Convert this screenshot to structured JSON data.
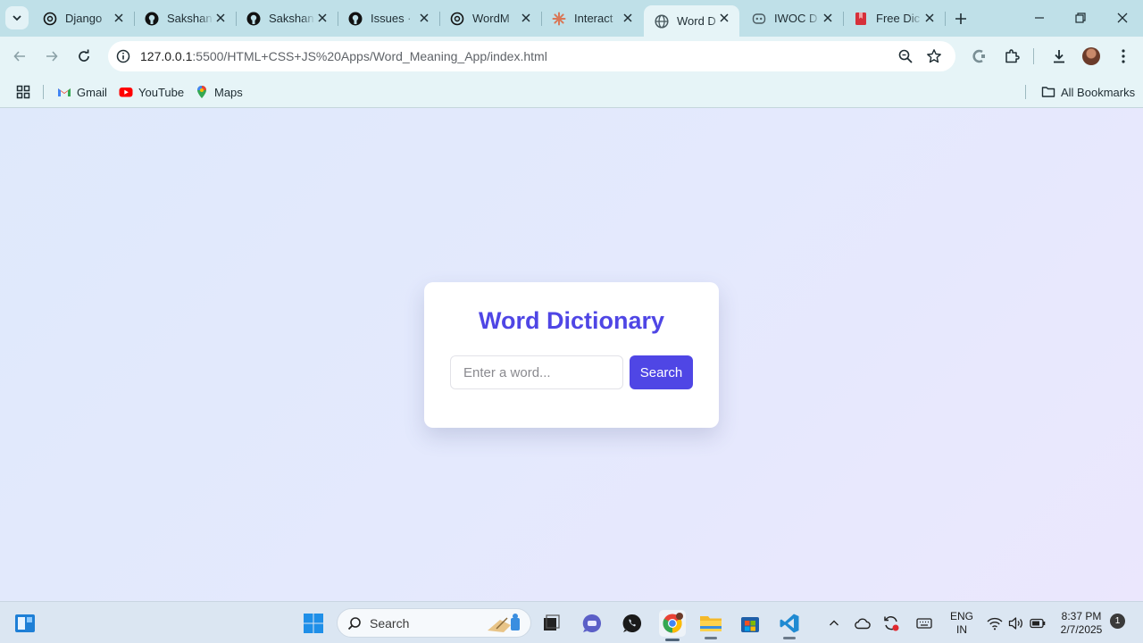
{
  "browser": {
    "tabs": [
      {
        "title": "Django",
        "favicon": "chatgpt-icon"
      },
      {
        "title": "Sakshan",
        "favicon": "github-icon"
      },
      {
        "title": "Sakshan",
        "favicon": "github-icon"
      },
      {
        "title": "Issues · ",
        "favicon": "github-icon"
      },
      {
        "title": "WordM",
        "favicon": "chatgpt-icon"
      },
      {
        "title": "Interact",
        "favicon": "claude-icon"
      },
      {
        "title": "Word D",
        "favicon": "globe-icon",
        "active": true
      },
      {
        "title": "IWOC D",
        "favicon": "discord-icon"
      },
      {
        "title": "Free Dic",
        "favicon": "bookmark-red-icon"
      }
    ],
    "url": "127.0.0.1:5500/HTML+CSS+JS%20Apps/Word_Meaning_App/index.html",
    "bookmarks": [
      {
        "label": "Gmail",
        "icon": "gmail-icon"
      },
      {
        "label": "YouTube",
        "icon": "youtube-icon"
      },
      {
        "label": "Maps",
        "icon": "maps-icon"
      }
    ],
    "all_bookmarks_label": "All Bookmarks"
  },
  "app": {
    "title": "Word Dictionary",
    "input_placeholder": "Enter a word...",
    "input_value": "",
    "search_label": "Search",
    "accent_color": "#4f46e5"
  },
  "taskbar": {
    "search_label": "Search",
    "lang_line1": "ENG",
    "lang_line2": "IN",
    "time": "8:37 PM",
    "date": "2/7/2025",
    "notification_count": "1"
  }
}
